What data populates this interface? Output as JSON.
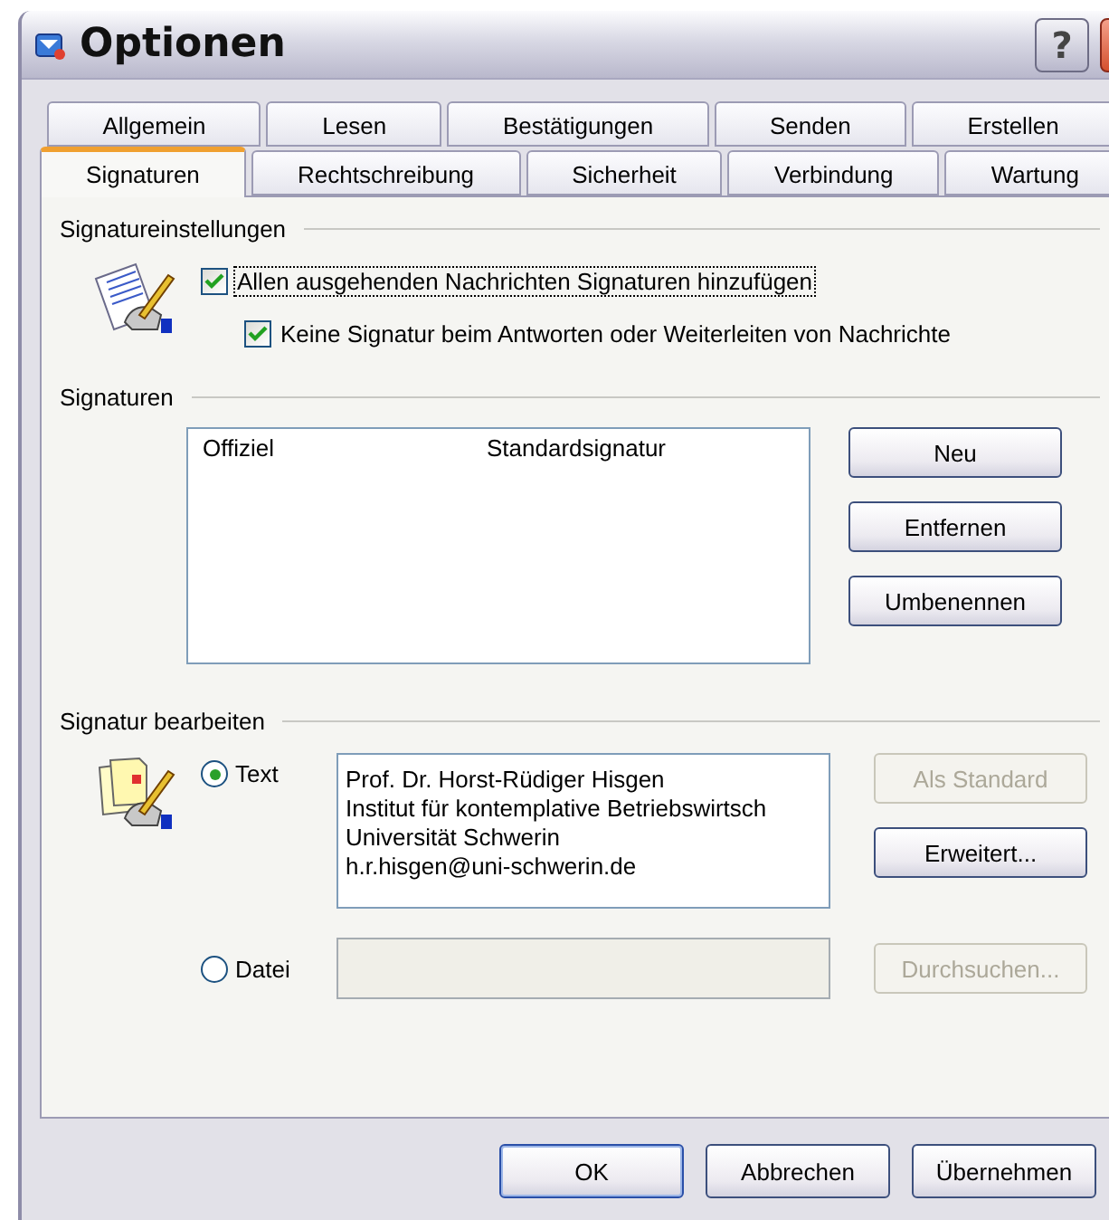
{
  "window": {
    "title": "Optionen",
    "help_label": "?"
  },
  "tab_rows": [
    {
      "tabs": [
        {
          "label": "Allgemein",
          "selected": false
        },
        {
          "label": "Lesen",
          "selected": false
        },
        {
          "label": "Bestätigungen",
          "selected": false
        },
        {
          "label": "Senden",
          "selected": false
        },
        {
          "label": "Erstellen",
          "selected": false
        }
      ]
    },
    {
      "tabs": [
        {
          "label": "Signaturen",
          "selected": true
        },
        {
          "label": "Rechtschreibung",
          "selected": false
        },
        {
          "label": "Sicherheit",
          "selected": false
        },
        {
          "label": "Verbindung",
          "selected": false
        },
        {
          "label": "Wartung",
          "selected": false
        }
      ]
    }
  ],
  "signature_settings": {
    "heading": "Signatureinstellungen",
    "options": [
      {
        "label": "Allen ausgehenden Nachrichten Signaturen hinzufügen",
        "checked": true,
        "focused": true
      },
      {
        "label": "Keine Signatur beim Antworten oder Weiterleiten von Nachrichte",
        "checked": true,
        "focused": false
      }
    ]
  },
  "signatures": {
    "heading": "Signaturen",
    "rows": [
      {
        "name": "Offiziel",
        "type": "Standardsignatur",
        "selected": false
      }
    ],
    "buttons": [
      {
        "label": "Neu",
        "disabled": false
      },
      {
        "label": "Entfernen",
        "disabled": false
      },
      {
        "label": "Umbenennen",
        "disabled": false
      }
    ]
  },
  "edit_signature": {
    "heading": "Signatur bearbeiten",
    "text_option": {
      "label": "Text",
      "selected": true,
      "lines": [
        "Prof. Dr. Horst-Rüdiger Hisgen",
        "Institut für kontemplative Betriebswirtsch",
        "Universität Schwerin",
        "h.r.hisgen@uni-schwerin.de"
      ],
      "buttons": [
        {
          "label": "Als Standard",
          "disabled": true
        },
        {
          "label": "Erweitert...",
          "disabled": false
        }
      ]
    },
    "file_option": {
      "label": "Datei",
      "selected": false,
      "field_disabled": true,
      "button": {
        "label": "Durchsuchen...",
        "disabled": true
      }
    }
  },
  "footer_buttons": [
    {
      "label": "OK",
      "default": true
    },
    {
      "label": "Abbrechen",
      "default": false
    },
    {
      "label": "Übernehmen",
      "default": false
    }
  ]
}
